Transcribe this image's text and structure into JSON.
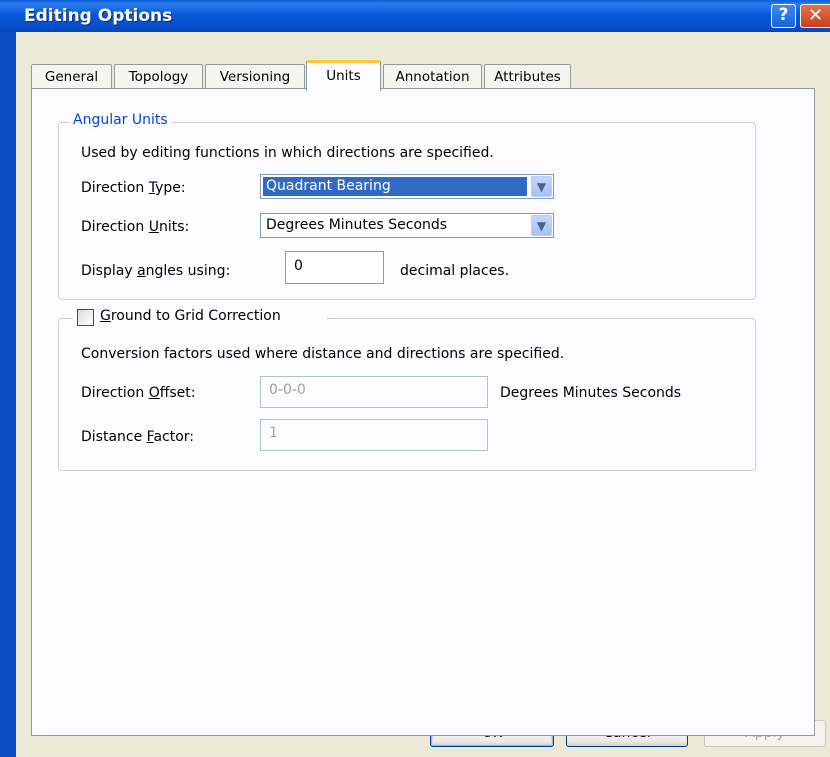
{
  "window": {
    "title": "Editing Options",
    "help_glyph": "?",
    "close_glyph": "✕"
  },
  "tabs": [
    "General",
    "Topology",
    "Versioning",
    "Units",
    "Annotation",
    "Attributes"
  ],
  "active_tab": "Units",
  "angular_units": {
    "legend": "Angular Units",
    "description": "Used by editing functions in which directions are specified.",
    "direction_type": {
      "label_pre": "Direction ",
      "label_accel": "T",
      "label_post": "ype:",
      "value": "Quadrant Bearing"
    },
    "direction_units": {
      "label_pre": "Direction ",
      "label_accel": "U",
      "label_post": "nits:",
      "value": "Degrees Minutes Seconds"
    },
    "display_angles": {
      "label_pre": "Display ",
      "label_accel": "a",
      "label_post": "ngles using:",
      "value": "0",
      "suffix": "decimal places."
    }
  },
  "ground_to_grid": {
    "checked": false,
    "label_accel": "G",
    "label_post": "round to Grid Correction",
    "description": "Conversion factors used where distance and directions are specified.",
    "direction_offset": {
      "label_pre": "Direction ",
      "label_accel": "O",
      "label_post": "ffset:",
      "value": "0-0-0",
      "units": "Degrees Minutes Seconds"
    },
    "distance_factor": {
      "label_pre": "Distance ",
      "label_accel": "F",
      "label_post": "actor:",
      "value": "1"
    }
  },
  "buttons": {
    "ok": "OK",
    "cancel": "Cancel",
    "apply": "Apply"
  },
  "icons": {
    "dropdown": "chevron-down-icon",
    "help": "help-icon",
    "close": "close-icon"
  },
  "colors": {
    "titlebar": "#0A58D6",
    "dialog_bg": "#ECE9D8",
    "panel_bg": "#FCFCFE",
    "legend": "#0046D5",
    "selection": "#316AC5"
  }
}
